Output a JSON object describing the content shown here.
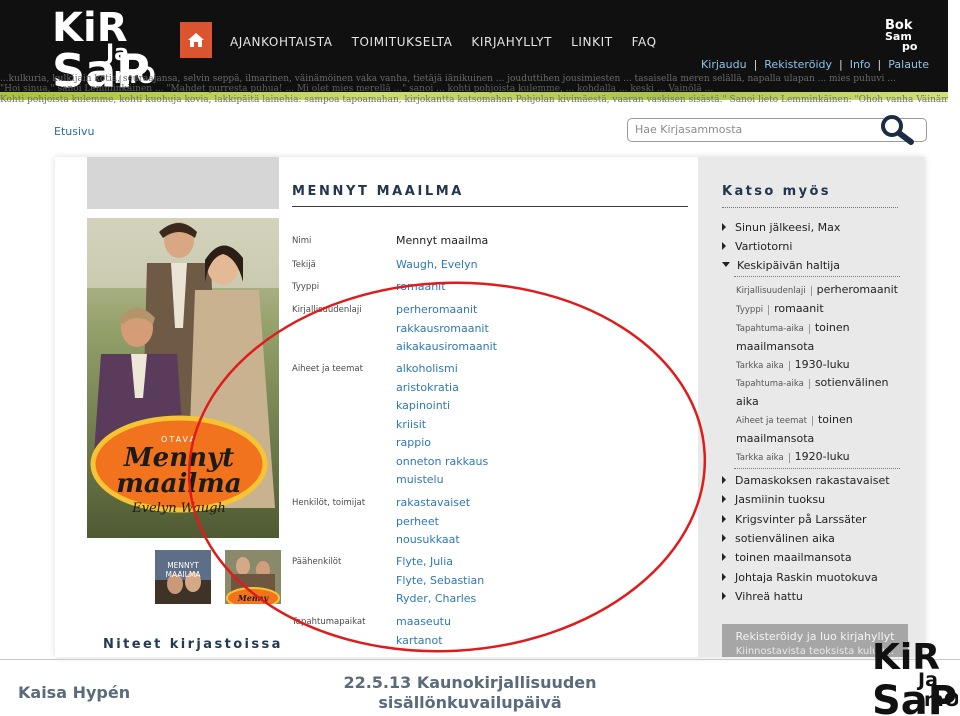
{
  "header": {
    "logo_text": [
      "KiR",
      "Ja",
      "mO",
      "SaP"
    ],
    "booksampo_text": [
      "Bok",
      "Sam",
      "po"
    ],
    "nav": [
      "AJANKOHTAISTA",
      "TOIMITUKSELTA",
      "KIRJAHYLLYT",
      "LINKIT",
      "FAQ"
    ],
    "userlinks": [
      "Kirjaudu",
      "Rekisteröidy",
      "Info",
      "Palaute"
    ],
    "strip_lines": [
      "...kulkuria, kulkijain kotia, seuraajansa, selvin seppä, ilmarinen, väinämöinen vaka vanha, tietäjä iänikuinen ... jouduttihen jousimiesten ... tasaisella meren selällä, napalla ulapan ... mies puhuvi ...",
      "\"Hoi sinua,\" sanoi Lemminkäinen ... \"Mahdet purresta puhua! ... Mi olet mies merellä ...\" sanoi ... kohti pohjoista kulemme, ... kohdalla ... keski ... Vainölä ...",
      "Kohti pohjoista kulemme, kohti kuohuja kovia, lakkipäitä lainehia: sampoa tapoamahan, kirjokantta katsomahan Pohjolan kivimäestä, vaaran vaskisen sisästä.\" Sanoi lieto Lemminkäinen: \"Ohoh vanha Väinämöinen ..."
    ]
  },
  "breadcrumb": "Etusivu",
  "search": {
    "placeholder": "Hae Kirjasammosta"
  },
  "book": {
    "title": "MENNYT MAAILMA",
    "cover": {
      "publisher": "OTAVA",
      "title_line1": "Mennyt",
      "title_line2": "maailma",
      "author": "Evelyn Waugh",
      "thumb1_line1": "MENNYT",
      "thumb1_line2": "MAAILMA",
      "thumb2_text": "Menny"
    },
    "rows": [
      {
        "label": "Nimi",
        "values": [
          "Mennyt maailma"
        ],
        "plain": true
      },
      {
        "label": "Tekijä",
        "values": [
          "Waugh, Evelyn"
        ]
      },
      {
        "label": "Tyyppi",
        "values": [
          "romaanit"
        ]
      },
      {
        "label": "Kirjallisuudenlaji",
        "values": [
          "perheromaanit",
          "rakkausromaanit",
          "aikakausiromaanit"
        ]
      },
      {
        "label": "Aiheet ja teemat",
        "values": [
          "alkoholismi",
          "aristokratia",
          "kapinointi",
          "kriisit",
          "rappio",
          "onneton rakkaus",
          "muistelu"
        ]
      },
      {
        "label": "Henkilöt, toimijat",
        "values": [
          "rakastavaiset",
          "perheet",
          "nousukkaat"
        ]
      },
      {
        "label": "Päähenkilöt",
        "values": [
          "Flyte, Julia",
          "Flyte, Sebastian",
          "Ryder, Charles"
        ]
      },
      {
        "label": "Tapahtumapaikat",
        "values": [
          "maaseutu",
          "kartanot"
        ]
      }
    ],
    "niteet": "Niteet kirjastoissa"
  },
  "sidebar": {
    "title": "Katso myös",
    "items_before": [
      "Sinun jälkeesi, Max",
      "Vartiotorni"
    ],
    "expanded": {
      "label": "Keskipäivän haltija",
      "meta": [
        {
          "key": "Kirjallisuudenlaji",
          "value": "perheromaanit"
        },
        {
          "key": "Tyyppi",
          "value": "romaanit"
        },
        {
          "key": "Tapahtuma-aika",
          "value": "toinen",
          "cont": "maailmansota"
        },
        {
          "key": "Tarkka aika",
          "value": "1930-luku"
        },
        {
          "key": "Tapahtuma-aika",
          "value": "sotienvälinen",
          "cont": "aika"
        },
        {
          "key": "Aiheet ja teemat",
          "value": "toinen",
          "cont": "maailmansota"
        },
        {
          "key": "Tarkka aika",
          "value": "1920-luku"
        }
      ]
    },
    "items_after": [
      "Damaskoksen rakastavaiset",
      "Jasmiinin tuoksu",
      "Krigsvinter på Larssäter",
      "sotienvälinen aika",
      "toinen maailmansota",
      "Johtaja Raskin muotokuva",
      "Vihreä hattu"
    ],
    "register": {
      "line1": "Rekisteröidy ja luo kirjahyllyt",
      "line2": "Kiinnostavista teoksista kuluu..."
    }
  },
  "footer": {
    "author": "Kaisa Hypén",
    "title_line1": "22.5.13 Kaunokirjallisuuden",
    "title_line2": "sisällönkuvailupäivä"
  },
  "colors": {
    "header_bg": "#101010",
    "home_accent": "#d9542f",
    "link": "#2d78b6",
    "heading": "#23364f",
    "sidebar_bg": "#e9e9e9",
    "ellipse": "#e01b1b",
    "footer_text": "#5a6b7c"
  }
}
